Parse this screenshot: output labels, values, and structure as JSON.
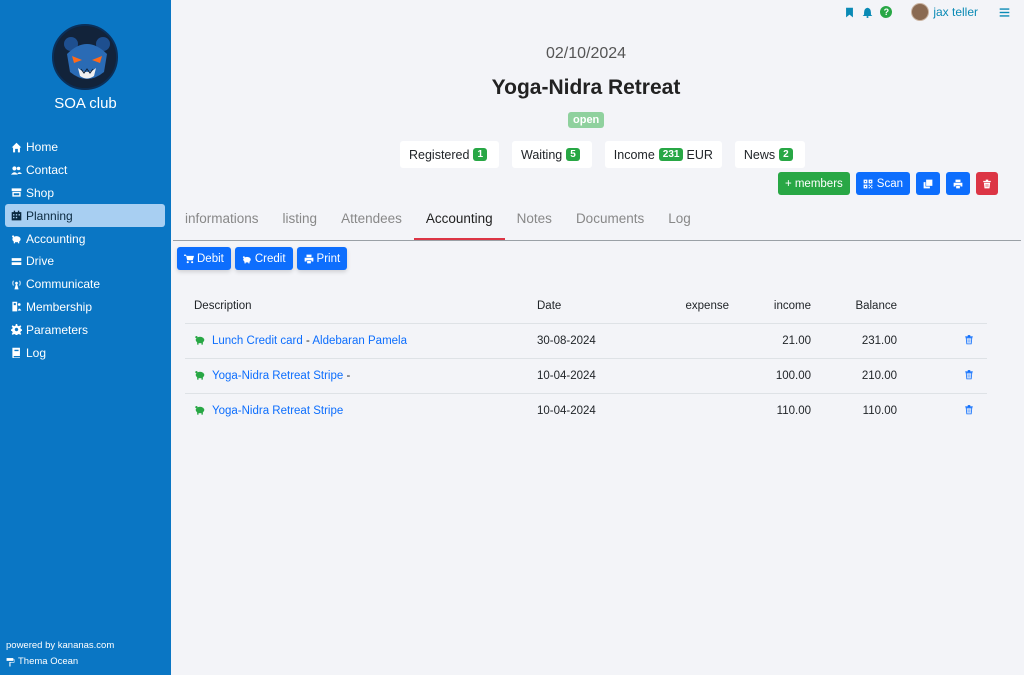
{
  "sidebar": {
    "club_name": "SOA club",
    "items": [
      {
        "label": "Home",
        "icon": "home-icon"
      },
      {
        "label": "Contact",
        "icon": "users-icon"
      },
      {
        "label": "Shop",
        "icon": "store-icon"
      },
      {
        "label": "Planning",
        "icon": "calendar-icon"
      },
      {
        "label": "Accounting",
        "icon": "piggy-bank-icon"
      },
      {
        "label": "Drive",
        "icon": "drive-icon"
      },
      {
        "label": "Communicate",
        "icon": "broadcast-icon"
      },
      {
        "label": "Membership",
        "icon": "id-card-icon"
      },
      {
        "label": "Parameters",
        "icon": "gear-icon"
      },
      {
        "label": "Log",
        "icon": "book-icon"
      }
    ],
    "active_item": "Planning",
    "powered_by": "powered by kananas.com",
    "theme": "Thema Ocean"
  },
  "topbar": {
    "help": "?",
    "username": "jax teller"
  },
  "event": {
    "date": "02/10/2024",
    "title": "Yoga-Nidra Retreat",
    "status": "open",
    "counters": {
      "registered_label": "Registered",
      "registered_value": "1",
      "waiting_label": "Waiting",
      "waiting_value": "5",
      "income_label": "Income",
      "income_value": "231",
      "income_currency": "EUR",
      "news_label": "News",
      "news_value": "2"
    }
  },
  "actions": {
    "members_label": "+ members",
    "scan_label": "Scan"
  },
  "tabs": [
    "informations",
    "listing",
    "Attendees",
    "Accounting",
    "Notes",
    "Documents",
    "Log"
  ],
  "active_tab": "Accounting",
  "toolbar": {
    "debit_label": "Debit",
    "credit_label": "Credit",
    "print_label": "Print"
  },
  "table": {
    "headers": {
      "description": "Description",
      "date": "Date",
      "expense": "expense",
      "income": "income",
      "balance": "Balance"
    },
    "rows": [
      {
        "description": "Lunch Credit card",
        "separator": " - ",
        "person": "Aldebaran Pamela",
        "date": "30-08-2024",
        "expense": "",
        "income": "21.00",
        "balance": "231.00"
      },
      {
        "description": "Yoga-Nidra Retreat Stripe",
        "separator": " -",
        "person": "",
        "date": "10-04-2024",
        "expense": "",
        "income": "100.00",
        "balance": "210.00"
      },
      {
        "description": "Yoga-Nidra Retreat Stripe",
        "separator": "",
        "person": "",
        "date": "10-04-2024",
        "expense": "",
        "income": "110.00",
        "balance": "110.00"
      }
    ]
  },
  "colors": {
    "sidebar": "#0a76c4",
    "primary": "#0d6efd",
    "success": "#28a745",
    "danger": "#dc3545",
    "username": "#0a8ab5"
  }
}
